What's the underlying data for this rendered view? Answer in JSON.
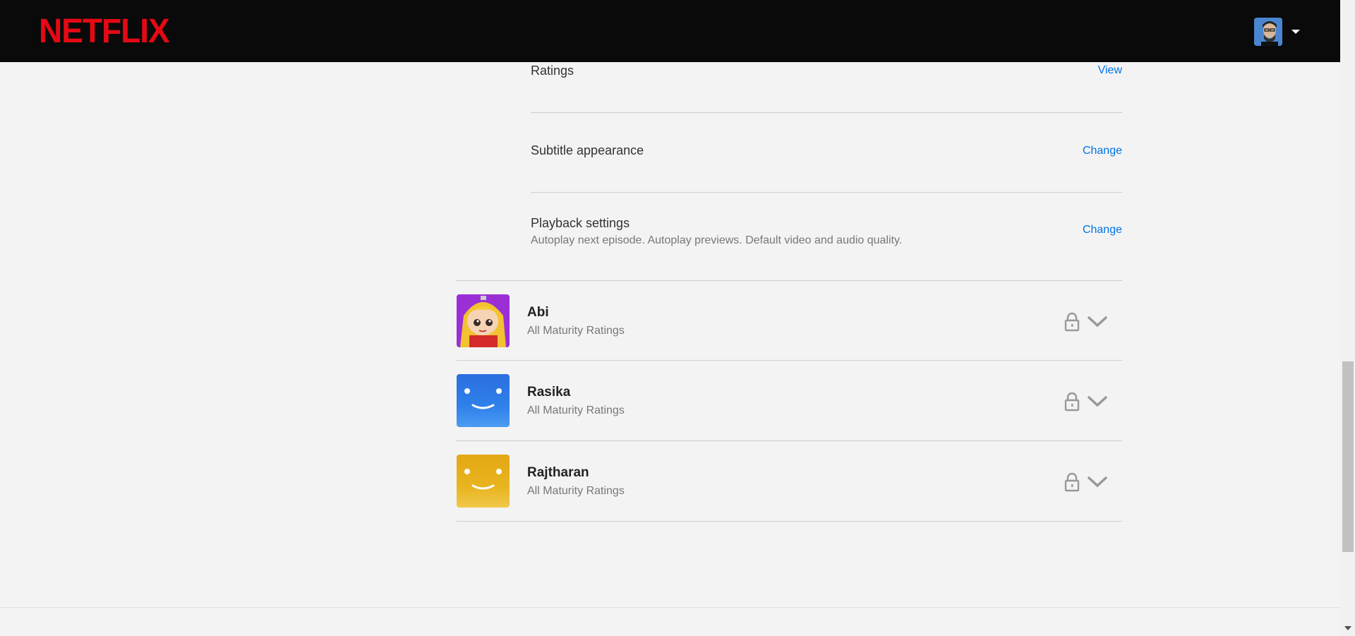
{
  "header": {
    "logo_text": "NETFLIX",
    "account_menu": "account-avatar"
  },
  "settings": [
    {
      "title": "Ratings",
      "subtitle": "",
      "action": "View"
    },
    {
      "title": "Subtitle appearance",
      "subtitle": "",
      "action": "Change"
    },
    {
      "title": "Playback settings",
      "subtitle": "Autoplay next episode. Autoplay previews. Default video and audio quality.",
      "action": "Change"
    }
  ],
  "profiles": [
    {
      "name": "Abi",
      "rating": "All Maturity Ratings",
      "avatar": "cartoon-girl",
      "avatar_color": "#9b2fd6"
    },
    {
      "name": "Rasika",
      "rating": "All Maturity Ratings",
      "avatar": "smiley-blue",
      "avatar_color": "#2b7de0"
    },
    {
      "name": "Rajtharan",
      "rating": "All Maturity Ratings",
      "avatar": "smiley-yellow",
      "avatar_color": "#e6b01a"
    }
  ],
  "colors": {
    "brand": "#e50914",
    "link": "#0073e6",
    "background": "#f3f3f3",
    "topbar": "#0a0a0a"
  }
}
